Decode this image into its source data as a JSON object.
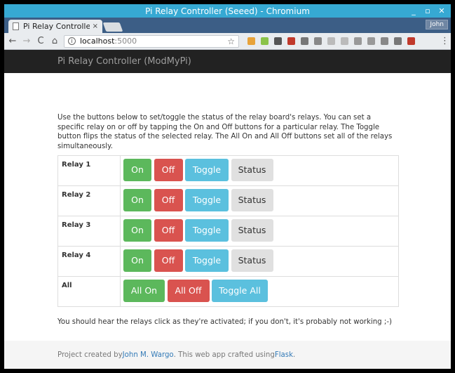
{
  "window": {
    "title": "Pi Relay Controller (Seeed) - Chromium",
    "controls": {
      "minimize": "_",
      "maximize": "▫",
      "close": "✕"
    }
  },
  "tabstrip": {
    "tab_title": "Pi Relay Controller",
    "tab_close": "×",
    "profile": "John"
  },
  "toolbar": {
    "back": "←",
    "forward": "→",
    "reload": "C",
    "home": "⌂",
    "url_host": "localhost",
    "url_port": ":5000",
    "star": "☆",
    "menu": "⋮",
    "extension_colors": [
      "#e8a33a",
      "#8bc34a",
      "#555555",
      "#c0392b",
      "#777777",
      "#888888",
      "#bbbbbb",
      "#bbbbbb",
      "#999999",
      "#999999",
      "#888888",
      "#777777",
      "#c0392b"
    ]
  },
  "page": {
    "brand": "Pi Relay Controller (ModMyPi)",
    "intro": "Use the buttons below to set/toggle the status of the relay board's relays. You can set a specific relay on or off by tapping the On and Off buttons for a particular relay. The Toggle button flips the status of the selected relay. The All On and All Off buttons set all of the relays simultaneously.",
    "relays": [
      {
        "label": "Relay 1",
        "on": "On",
        "off": "Off",
        "toggle": "Toggle",
        "status": "Status"
      },
      {
        "label": "Relay 2",
        "on": "On",
        "off": "Off",
        "toggle": "Toggle",
        "status": "Status"
      },
      {
        "label": "Relay 3",
        "on": "On",
        "off": "Off",
        "toggle": "Toggle",
        "status": "Status"
      },
      {
        "label": "Relay 4",
        "on": "On",
        "off": "Off",
        "toggle": "Toggle",
        "status": "Status"
      }
    ],
    "all": {
      "label": "All",
      "all_on": "All On",
      "all_off": "All Off",
      "toggle_all": "Toggle All"
    },
    "note": "You should hear the relays click as they're activated; if you don't, it's probably not working ;-)",
    "footer": {
      "prefix": "Project created by ",
      "author": "John M. Wargo",
      "middle": ". This web app crafted using ",
      "framework": "Flask",
      "suffix": "."
    }
  },
  "colors": {
    "titlebar": "#36a9d3",
    "navbar": "#222222",
    "on": "#5cb85c",
    "off": "#d9534f",
    "toggle": "#5bc0de",
    "status": "#e0e0e0",
    "link": "#337ab7"
  }
}
